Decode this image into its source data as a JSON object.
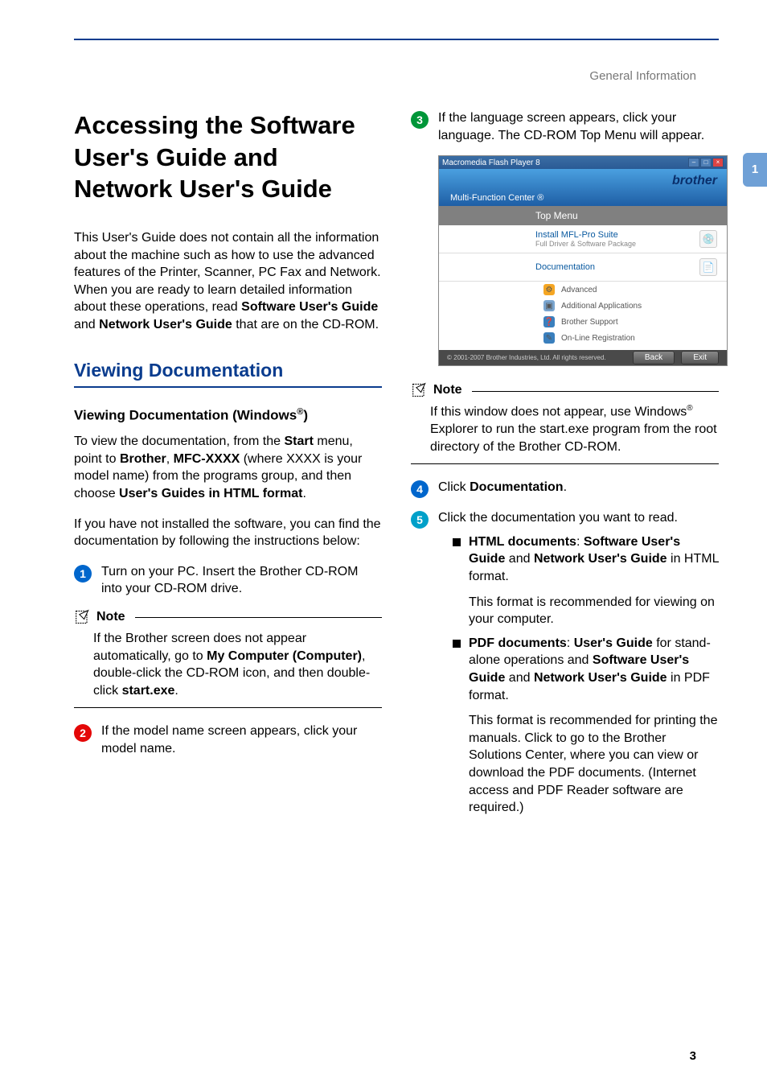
{
  "header": "General Information",
  "side_tab": "1",
  "page_number": "3",
  "left": {
    "h1": "Accessing the Software User's Guide and Network User's Guide",
    "intro_parts": {
      "a": "This User's Guide does not contain all the information about the machine such as how to use the advanced features of the Printer, Scanner, PC Fax and Network. When you are ready to learn detailed information about these operations, read ",
      "b": "Software User's Guide",
      "c": " and ",
      "d": "Network User's Guide",
      "e": " that are on the CD-ROM."
    },
    "h2": "Viewing Documentation",
    "h3_parts": {
      "a": "Viewing Documentation (Windows",
      "sup": "®",
      "b": ")"
    },
    "p1": {
      "a": "To view the documentation, from the ",
      "b": "Start",
      "c": " menu, point to ",
      "d": "Brother",
      "e": ", ",
      "f": "MFC-XXXX",
      "g": " (where XXXX is your model name) from the programs group, and then choose ",
      "h": "User's Guides in HTML format",
      "i": "."
    },
    "p2": "If you have not installed the software, you can find the documentation by following the instructions below:",
    "step1": "Turn on your PC. Insert the Brother CD-ROM into your CD-ROM drive.",
    "note1": {
      "label": "Note",
      "a": "If the Brother screen does not appear automatically, go to ",
      "b": "My Computer (Computer)",
      "c": ", double-click the CD-ROM icon, and then double-click ",
      "d": "start.exe",
      "e": "."
    },
    "step2": "If the model name screen appears, click your model name."
  },
  "right": {
    "step3": "If the language screen appears, click your language. The CD-ROM Top Menu will appear.",
    "screenshot": {
      "titlebar": "Macromedia Flash Player 8",
      "logo": "brother",
      "mfc": "Multi-Function Center ®",
      "top_menu": "Top Menu",
      "row1_main": "Install MFL-Pro Suite",
      "row1_sub": "Full Driver & Software Package",
      "row2_main": "Documentation",
      "sub1": "Advanced",
      "sub2": "Additional Applications",
      "sub3": "Brother Support",
      "sub4": "On-Line Registration",
      "copyright": "© 2001-2007 Brother Industries, Ltd. All rights reserved.",
      "back": "Back",
      "exit": "Exit"
    },
    "note2": {
      "label": "Note",
      "a": "If this window does not appear, use Windows",
      "sup": "®",
      "b": " Explorer to run the start.exe program from the root directory of the Brother CD-ROM."
    },
    "step4": {
      "a": "Click ",
      "b": "Documentation",
      "c": "."
    },
    "step5": "Click the documentation you want to read.",
    "bullet1": {
      "head": "HTML documents",
      "a": ": ",
      "b": "Software User's Guide",
      "c": " and ",
      "d": "Network User's Guide",
      "e": " in HTML format.",
      "sub": "This format is recommended for viewing on your computer."
    },
    "bullet2": {
      "head": "PDF documents",
      "a": ": ",
      "b": "User's Guide",
      "c": " for stand-alone operations and ",
      "d": "Software User's Guide",
      "e": " and ",
      "f": "Network User's Guide",
      "g": " in PDF format.",
      "sub": "This format is recommended for printing the manuals. Click to go to the Brother Solutions Center, where you can view or download the PDF documents. (Internet access and PDF Reader software are required.)"
    }
  }
}
